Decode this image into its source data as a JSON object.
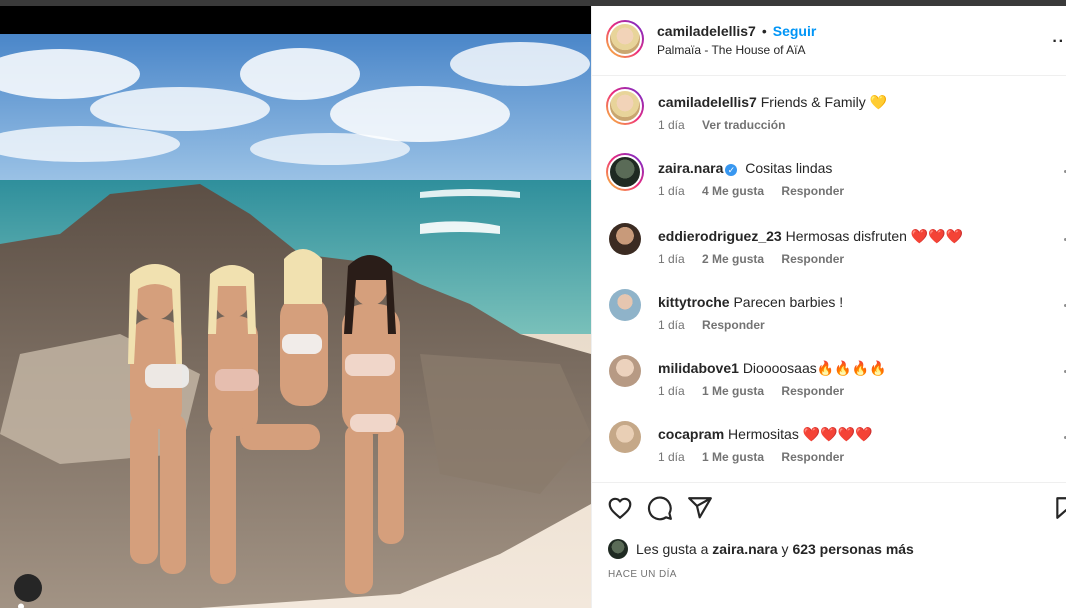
{
  "post": {
    "author": "camiladelellis7",
    "separator": "•",
    "follow_label": "Seguir",
    "location": "Palmaïa - The House of AïA",
    "more_label": "··"
  },
  "caption": {
    "username": "camiladelellis7",
    "text": "Friends & Family",
    "emoji": "💛",
    "time": "1 día",
    "translate_label": "Ver traducción"
  },
  "comments": [
    {
      "username": "zaira.nara",
      "verified": true,
      "text": "Cositas lindas",
      "emoji": "",
      "time": "1 día",
      "likes": "4 Me gusta",
      "reply": "Responder"
    },
    {
      "username": "eddierodriguez_23",
      "verified": false,
      "text": "Hermosas disfruten",
      "emoji": "❤️❤️❤️",
      "time": "1 día",
      "likes": "2 Me gusta",
      "reply": "Responder"
    },
    {
      "username": "kittytroche",
      "verified": false,
      "text": "Parecen barbies !",
      "emoji": "",
      "time": "1 día",
      "likes": "",
      "reply": "Responder"
    },
    {
      "username": "milidabove1",
      "verified": false,
      "text": "Dioooosaas",
      "emoji": "🔥🔥🔥🔥",
      "time": "1 día",
      "likes": "1 Me gusta",
      "reply": "Responder"
    },
    {
      "username": "cocapram",
      "verified": false,
      "text": "Hermositas",
      "emoji": "❤️❤️❤️❤️",
      "time": "1 día",
      "likes": "1 Me gusta",
      "reply": "Responder"
    }
  ],
  "actions": {
    "like_icon": "heart-icon",
    "comment_icon": "comment-icon",
    "share_icon": "send-icon",
    "save_icon": "bookmark-icon"
  },
  "likes_summary": {
    "prefix": "Les gusta a",
    "user": "zaira.nara",
    "conjunction": "y",
    "others": "623 personas más"
  },
  "timestamp": "HACE UN DÍA",
  "colors": {
    "accent": "#0095f6",
    "verified": "#3897f0",
    "text": "#262626",
    "secondary": "#737373"
  }
}
